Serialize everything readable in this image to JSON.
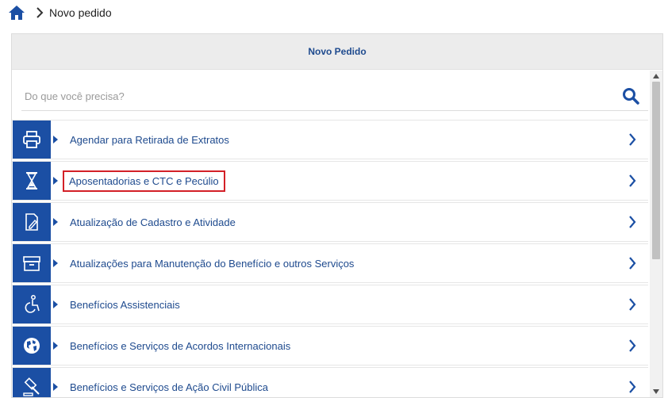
{
  "breadcrumb": {
    "current": "Novo pedido"
  },
  "panel": {
    "title": "Novo Pedido"
  },
  "search": {
    "placeholder": "Do que você precisa?"
  },
  "items": [
    {
      "label": "Agendar para Retirada de Extratos",
      "icon": "printer-icon"
    },
    {
      "label": "Aposentadorias e CTC e Pecúlio",
      "icon": "hourglass-icon",
      "highlighted": true
    },
    {
      "label": "Atualização de Cadastro e Atividade",
      "icon": "document-edit-icon"
    },
    {
      "label": "Atualizações para Manutenção do Benefício e outros Serviços",
      "icon": "archive-box-icon"
    },
    {
      "label": "Benefícios Assistenciais",
      "icon": "wheelchair-icon"
    },
    {
      "label": "Benefícios e Serviços de Acordos Internacionais",
      "icon": "globe-icon"
    },
    {
      "label": "Benefícios e Serviços de Ação Civil Pública",
      "icon": "gavel-icon"
    }
  ],
  "colors": {
    "accent": "#1b4fa4",
    "highlight_border": "#d32027",
    "header_bg": "#ececec"
  }
}
